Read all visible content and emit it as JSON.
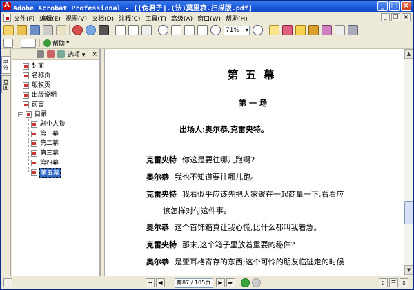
{
  "window": {
    "title": "Adobe Acrobat Professional - [[伪君子].(法)莫里哀.扫描版.pdf]",
    "minimize": "_",
    "maximize": "□",
    "close": "×"
  },
  "menu": {
    "items": [
      "文件(F)",
      "编辑(E)",
      "视图(V)",
      "文档(D)",
      "注释(C)",
      "工具(T)",
      "高级(A)",
      "窗口(W)",
      "帮助(H)"
    ],
    "mdi_minimize": "_",
    "mdi_restore": "❐",
    "mdi_close": "×"
  },
  "toolbar": {
    "zoom": "71%"
  },
  "toolbar2": {
    "help_label": "帮助"
  },
  "navigation": {
    "tab_bookmarks": "书签",
    "tab_pages": "页面"
  },
  "bookmarks": {
    "options_label": "选项",
    "items": [
      {
        "label": "封面"
      },
      {
        "label": "名称页"
      },
      {
        "label": "版权页"
      },
      {
        "label": "出版说明"
      },
      {
        "label": "前言"
      },
      {
        "label": "目录"
      },
      {
        "label": "剧中人物"
      },
      {
        "label": "第一幕"
      },
      {
        "label": "第二幕"
      },
      {
        "label": "第三幕"
      },
      {
        "label": "第四幕"
      },
      {
        "label": "第五幕"
      }
    ],
    "expander": "−"
  },
  "document": {
    "act_title": "第五幕",
    "scene_title": "第一场",
    "cast": "出场人:奥尔恭,克雷央特。",
    "lines": [
      {
        "speaker": "克雷央特",
        "text": "你这是要往哪儿跑啊?"
      },
      {
        "speaker": "奥尔恭",
        "text": "我也不知道要往哪儿跑。"
      },
      {
        "speaker": "克雷央特",
        "text": "我看似乎应该先把大家聚在一起商量一下,看看应"
      },
      {
        "speaker": "",
        "text": "该怎样对付这件事。"
      },
      {
        "speaker": "奥尔恭",
        "text": "这个首饰箱真让我心慌,比什么都叫我着急。"
      },
      {
        "speaker": "克雷央特",
        "text": "那末,这个箱子里放着重要的秘件?"
      },
      {
        "speaker": "奥尔恭",
        "text": "是亚耳格寄存的东西;这个可怜的朋友临逃走的时候"
      }
    ]
  },
  "status": {
    "page_field": "第87 / 105页"
  }
}
